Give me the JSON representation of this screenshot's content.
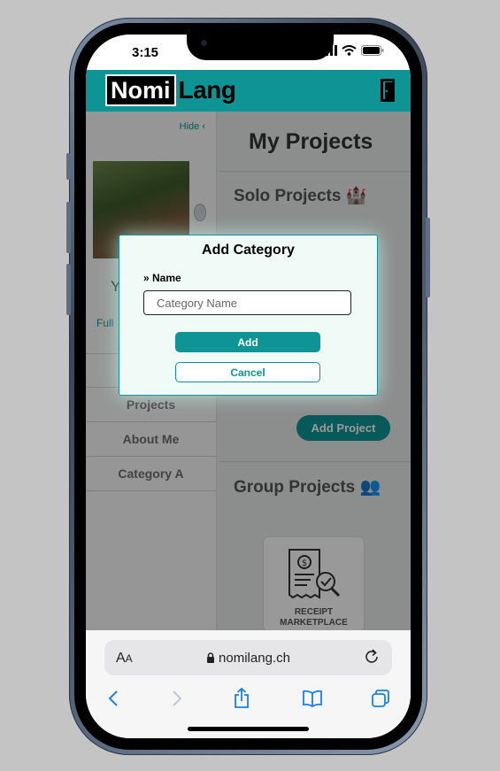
{
  "status_bar": {
    "time": "3:15"
  },
  "header": {
    "logo_part1": "Nomi",
    "logo_part2": "Lang"
  },
  "sidebar": {
    "hide_link": "Hide ‹",
    "profile_initial": "Y",
    "profile_label": "Full",
    "items": [
      {
        "label": ""
      },
      {
        "label": "Projects"
      },
      {
        "label": "About Me"
      },
      {
        "label": "Category A"
      }
    ]
  },
  "main": {
    "title": "My Projects",
    "solo_section": "Solo Projects 🏰",
    "add_project": "Add Project",
    "group_section": "Group Projects 👥",
    "card_label_line1": "RECEIPT",
    "card_label_line2": "MARKETPLACE"
  },
  "modal": {
    "title": "Add Category",
    "field_label": "» Name",
    "input_placeholder": "Category Name",
    "input_value": "",
    "add_label": "Add",
    "cancel_label": "Cancel"
  },
  "browser": {
    "aa_label_big": "A",
    "aa_label_small": "A",
    "url": "nomilang.ch"
  },
  "colors": {
    "accent": "#0e9494",
    "backdrop": "#c4c4c4"
  },
  "icons": {
    "lock": "lock-icon",
    "reload": "reload-icon",
    "back": "chevron-left-icon",
    "forward": "chevron-right-icon",
    "share": "share-icon",
    "bookmarks": "book-icon",
    "tabs": "tabs-icon",
    "logout": "door-icon"
  }
}
